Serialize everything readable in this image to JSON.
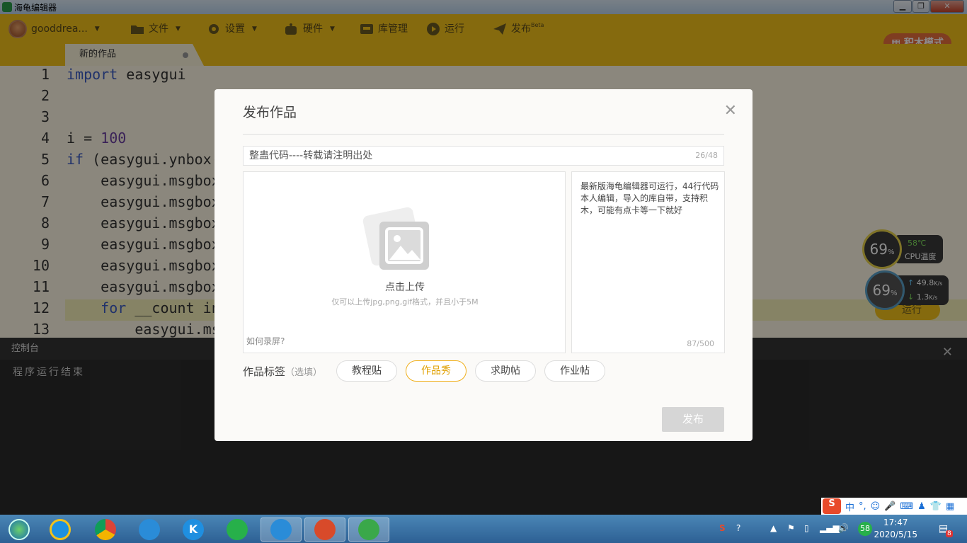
{
  "window": {
    "title": "海龟编辑器",
    "min": "▁",
    "max": "❐",
    "close": "✕"
  },
  "menubar": {
    "user": "gooddrea...",
    "file": "文件",
    "settings": "设置",
    "hardware": "硬件",
    "library": "库管理",
    "run": "运行",
    "publish": "发布",
    "publish_badge": "Beta",
    "block_mode": "积木模式"
  },
  "tab": {
    "label": "新的作品"
  },
  "editor": {
    "line_numbers": [
      "1",
      "2",
      "3",
      "4",
      "5",
      "6",
      "7",
      "8",
      "9",
      "10",
      "11",
      "12",
      "13"
    ],
    "lines": {
      "l1_kw": "import",
      "l1_rest": " easygui",
      "l4_a": "i = ",
      "l4_num": "100",
      "l5_kw": "if",
      "l5_rest": " (easygui.ynbox(",
      "l6": "    easygui.msgbox",
      "l7": "    easygui.msgbox",
      "l8": "    easygui.msgbox",
      "l9": "    easygui.msgbox",
      "l10": "    easygui.msgbox",
      "l11": "    easygui.msgbox",
      "l12_kw": "for",
      "l12_rest": " __count in",
      "l13": "        easygui.ms"
    }
  },
  "console": {
    "title": "控制台",
    "close": "✕",
    "output": "程序运行结束"
  },
  "dialog": {
    "title": "发布作品",
    "close": "✕",
    "work_title": "整蛊代码----转载请注明出处",
    "title_count": "26/48",
    "upload_label": "点击上传",
    "upload_hint": "仅可以上传jpg,png,gif格式，并且小于5M",
    "howto": "如何录屏?",
    "description": "最新版海龟编辑器可运行，44行代码本人编辑，导入的库自带，支持积木，可能有点卡等一下就好",
    "desc_count": "87/500",
    "tags_label": "作品标签",
    "tags_optional": "（选填）",
    "tags": [
      "教程贴",
      "作品秀",
      "求助帖",
      "作业帖"
    ],
    "publish_button": "发布"
  },
  "widget": {
    "gauge1": "69",
    "gauge2": "69",
    "percent": "%",
    "cpu_temp": "58℃",
    "cpu_label": "CPU温度",
    "up_speed": "49.8",
    "down_speed": "1.3",
    "speed_unit": "K/s",
    "behind_run": "运行"
  },
  "taskbar": {
    "time": "17:47",
    "date": "2020/5/15",
    "badge": "58",
    "notif": "8"
  },
  "ime": {
    "mode": "中"
  }
}
